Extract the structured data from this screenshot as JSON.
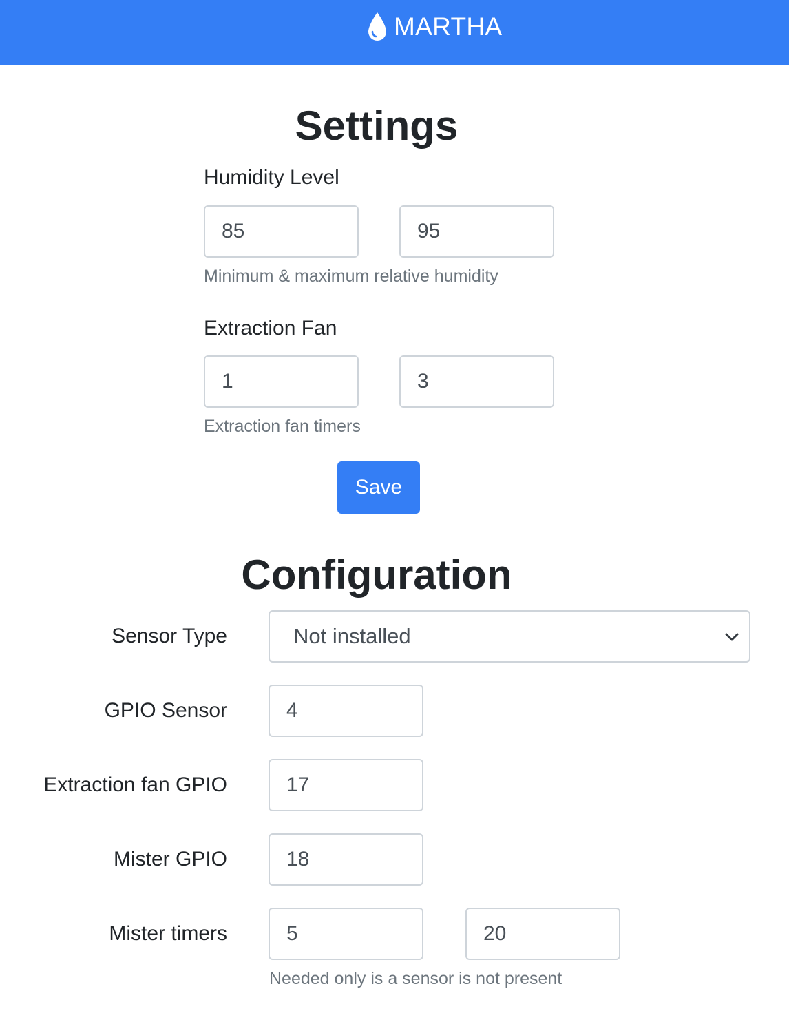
{
  "navbar": {
    "brand_icon": "water-drop-icon",
    "brand_text": "MARTHA",
    "color": "#347ef5"
  },
  "settings": {
    "title": "Settings",
    "humidity": {
      "label": "Humidity Level",
      "min_value": "85",
      "max_value": "95",
      "help": "Minimum & maximum relative humidity"
    },
    "fan": {
      "label": "Extraction Fan",
      "value_1": "1",
      "value_2": "3",
      "help": "Extraction fan timers"
    },
    "save_label": "Save"
  },
  "configuration": {
    "title": "Configuration",
    "sensor_type": {
      "label": "Sensor Type",
      "selected": "Not installed"
    },
    "gpio_sensor": {
      "label": "GPIO Sensor",
      "value": "4"
    },
    "fan_gpio": {
      "label": "Extraction fan GPIO",
      "value": "17"
    },
    "mister_gpio": {
      "label": "Mister GPIO",
      "value": "18"
    },
    "mister_timers": {
      "label": "Mister timers",
      "value_1": "5",
      "value_2": "20",
      "help": "Needed only is a sensor is not present"
    }
  }
}
